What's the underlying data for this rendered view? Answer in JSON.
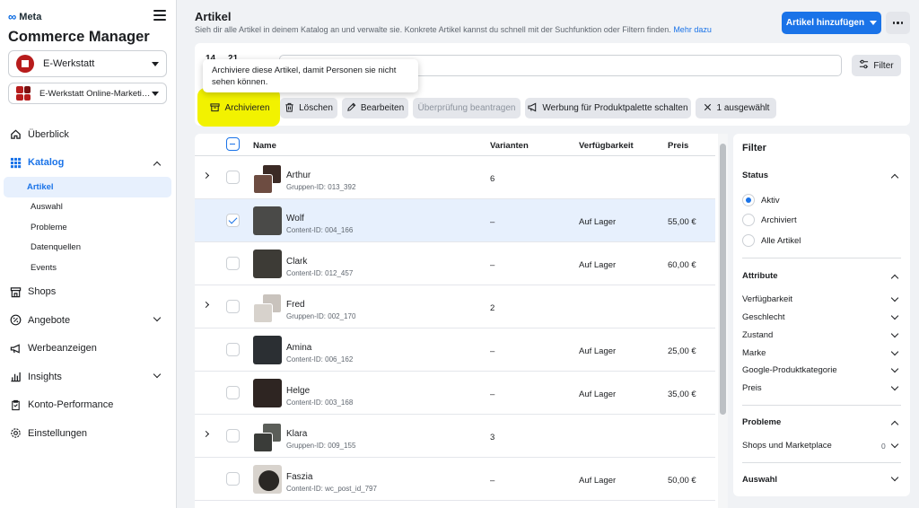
{
  "brand": {
    "name": "Meta"
  },
  "sidebar": {
    "title": "Commerce Manager",
    "shop_selector": "E-Werkstatt",
    "account_selector": "E-Werkstatt Online-Marketing...",
    "nav": {
      "overview": "Überblick",
      "catalog": "Katalog",
      "shops": "Shops",
      "offers": "Angebote",
      "ads": "Werbeanzeigen",
      "insights": "Insights",
      "account_performance": "Konto-Performance",
      "settings": "Einstellungen"
    },
    "catalog_sub": {
      "articles": "Artikel",
      "selection": "Auswahl",
      "problems": "Probleme",
      "data_sources": "Datenquellen",
      "events": "Events"
    }
  },
  "header": {
    "title": "Artikel",
    "description": "Sieh dir alle Artikel in deinem Katalog an und verwalte sie. Konkrete Artikel kannst du schnell mit der Suchfunktion oder Filtern finden.",
    "more_link": "Mehr dazu",
    "add_button": "Artikel hinzufügen"
  },
  "toolbar": {
    "date_label": "14 ... 21",
    "filter_button": "Filter",
    "tooltip": "Archiviere diese Artikel, damit Personen sie nicht sehen können.",
    "archive": "Archivieren",
    "delete": "Löschen",
    "edit": "Bearbeiten",
    "review": "Überprüfung beantragen",
    "promote": "Werbung für Produktpalette schalten",
    "selected": "1 ausgewählt"
  },
  "table": {
    "columns": {
      "name": "Name",
      "variants": "Varianten",
      "availability": "Verfügbarkeit",
      "price": "Preis"
    },
    "rows": [
      {
        "name": "Arthur",
        "id": "Gruppen-ID: 013_392",
        "variants": "6",
        "availability": "",
        "price": ""
      },
      {
        "name": "Wolf",
        "id": "Content-ID: 004_166",
        "variants": "–",
        "availability": "Auf Lager",
        "price": "55,00 €"
      },
      {
        "name": "Clark",
        "id": "Content-ID: 012_457",
        "variants": "–",
        "availability": "Auf Lager",
        "price": "60,00 €"
      },
      {
        "name": "Fred",
        "id": "Gruppen-ID: 002_170",
        "variants": "2",
        "availability": "",
        "price": ""
      },
      {
        "name": "Amina",
        "id": "Content-ID: 006_162",
        "variants": "–",
        "availability": "Auf Lager",
        "price": "25,00 €"
      },
      {
        "name": "Helge",
        "id": "Content-ID: 003_168",
        "variants": "–",
        "availability": "Auf Lager",
        "price": "35,00 €"
      },
      {
        "name": "Klara",
        "id": "Gruppen-ID: 009_155",
        "variants": "3",
        "availability": "",
        "price": ""
      },
      {
        "name": "Faszia",
        "id": "Content-ID: wc_post_id_797",
        "variants": "–",
        "availability": "Auf Lager",
        "price": "50,00 €"
      }
    ]
  },
  "filter_panel": {
    "title": "Filter",
    "status": {
      "heading": "Status",
      "options": [
        "Aktiv",
        "Archiviert",
        "Alle Artikel"
      ]
    },
    "attributes": {
      "heading": "Attribute",
      "items": [
        "Verfügbarkeit",
        "Geschlecht",
        "Zustand",
        "Marke",
        "Google-Produktkategorie",
        "Preis"
      ]
    },
    "problems": {
      "heading": "Probleme",
      "item": "Shops und Marketplace",
      "count": "0"
    },
    "selection": {
      "heading": "Auswahl"
    }
  },
  "colors": {
    "accent": "#1a73e8",
    "highlight": "#f2f200",
    "selected_row": "#e7f0fd"
  }
}
